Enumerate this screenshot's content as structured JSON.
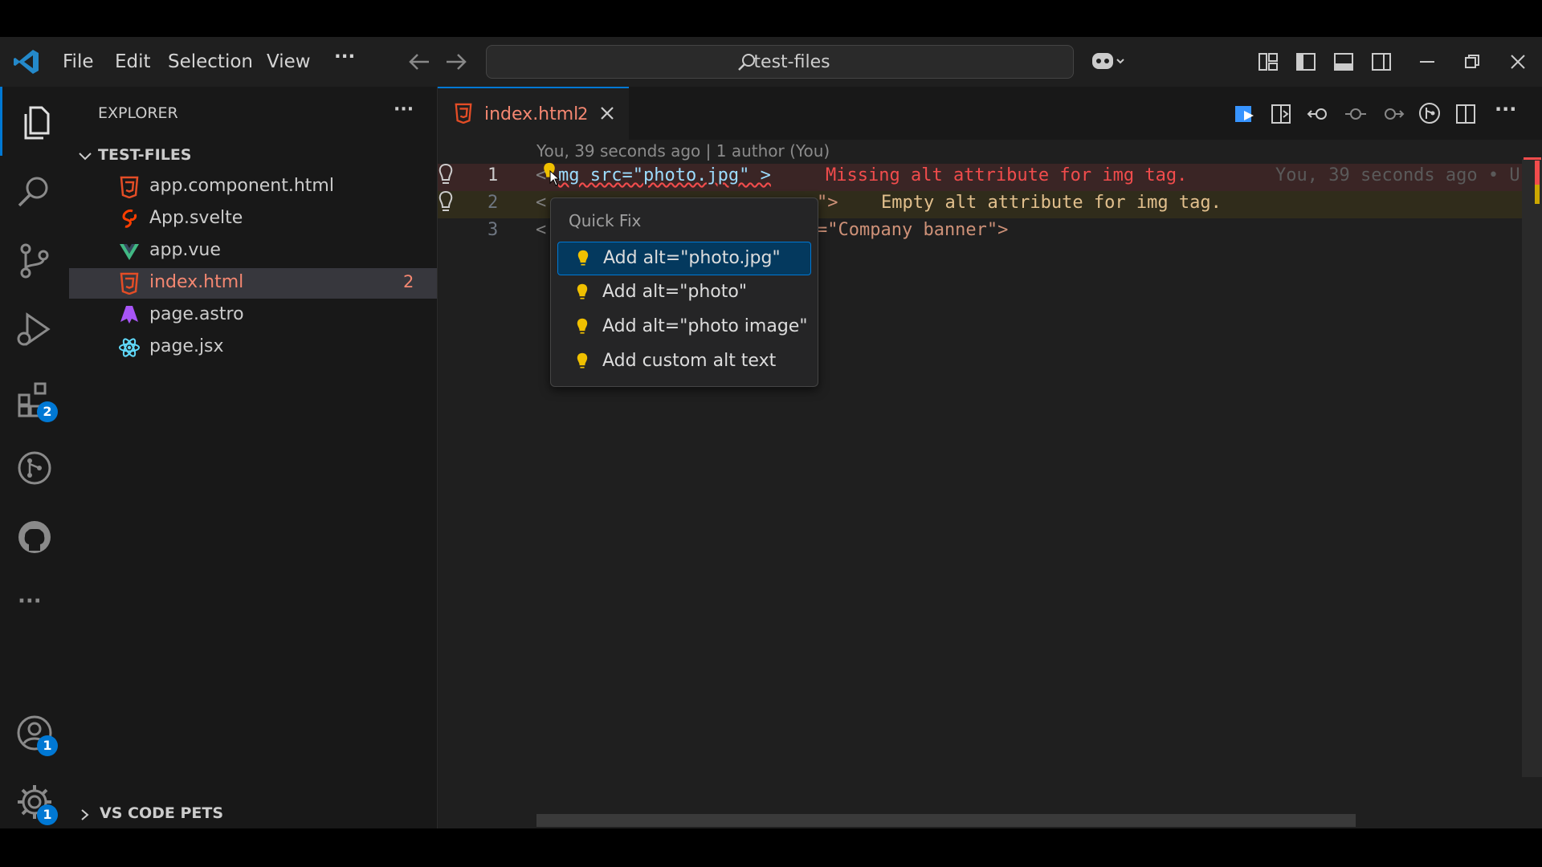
{
  "menu": {
    "file": "File",
    "edit": "Edit",
    "selection": "Selection",
    "view": "View",
    "more": "···"
  },
  "search": {
    "label": "test-files"
  },
  "activity": {
    "extensions_badge": "2",
    "accounts_badge": "1",
    "settings_badge": "1"
  },
  "explorer": {
    "title": "EXPLORER",
    "more": "···",
    "folder": "TEST-FILES",
    "files": [
      {
        "name": "app.component.html",
        "icon": "html-icon"
      },
      {
        "name": "App.svelte",
        "icon": "svelte-icon"
      },
      {
        "name": "app.vue",
        "icon": "vue-icon"
      },
      {
        "name": "index.html",
        "icon": "html-icon",
        "problems": "2"
      },
      {
        "name": "page.astro",
        "icon": "astro-icon"
      },
      {
        "name": "page.jsx",
        "icon": "react-icon"
      }
    ],
    "pets_section": "VS CODE PETS"
  },
  "tab": {
    "name": "index.html",
    "count": "2"
  },
  "editor": {
    "blame": "You, 39 seconds ago | 1 author (You)",
    "lines": [
      {
        "number": "1",
        "code_a": "<",
        "code_b": "mg src=\"photo.jpg\" >",
        "diag": "Missing alt attribute for img tag.",
        "blame": "You, 39 seconds ago • U"
      },
      {
        "number": "2",
        "code_a": "<",
        "code_b": "\">",
        "diag": "Empty alt attribute for img tag.",
        "blame": ""
      },
      {
        "number": "3",
        "code_a": "<",
        "code_b": "=\"Company banner\">",
        "diag": "",
        "blame": ""
      }
    ]
  },
  "quick_fix": {
    "title": "Quick Fix",
    "items": [
      "Add alt=\"photo.jpg\"",
      "Add alt=\"photo\"",
      "Add alt=\"photo image\"",
      "Add custom alt text"
    ]
  },
  "colors": {
    "accent": "#0078d4",
    "error": "#f14c4c",
    "warning": "#cca700",
    "html_icon": "#e44d26",
    "vue_icon": "#41b883",
    "astro_icon": "#a855f7",
    "react_icon": "#61dafb"
  }
}
